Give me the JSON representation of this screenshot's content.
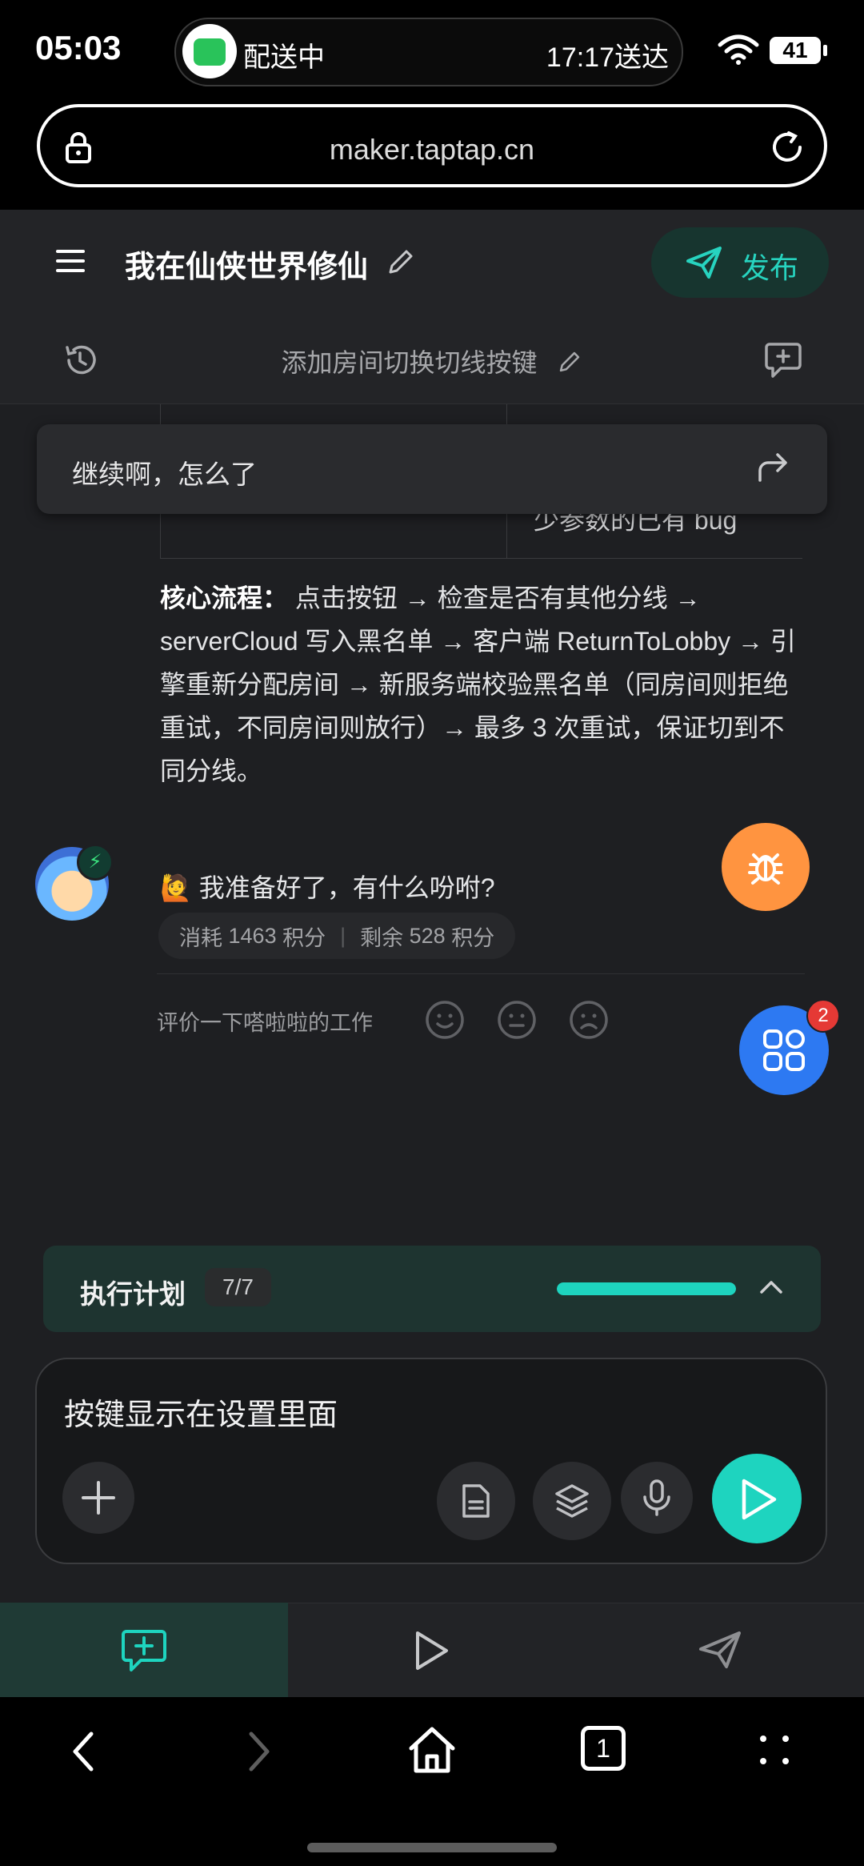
{
  "status_bar": {
    "time": "05:03",
    "live_activity_label": "配送中",
    "live_activity_eta": "17:17送达",
    "battery": "41"
  },
  "browser": {
    "url": "maker.taptap.cn"
  },
  "app": {
    "title": "我在仙侠世界修仙",
    "publish_label": "发布",
    "thread_title": "添加房间切换切线按键"
  },
  "chat": {
    "table_fragment_text": "少参数的已有 bug",
    "continue_prompt": "继续啊，怎么了",
    "core_flow_label": "核心流程：",
    "core_flow_text": "点击按钮 → 检查是否有其他分线 → serverCloud 写入黑名单 → 客户端 ReturnToLobby → 引擎重新分配房间 → 新服务端校验黑名单（同房间则拒绝重试，不同房间则放行）→ 最多 3 次重试，保证切到不同分线。",
    "ready_message": "我准备好了，有什么吩咐?",
    "ready_emoji": "🙋",
    "credits": {
      "spent_label": "消耗",
      "spent_value": "1463",
      "spent_unit": "积分",
      "separator": "|",
      "remain_label": "剩余",
      "remain_value": "528",
      "remain_unit": "积分"
    },
    "rating_prompt": "评价一下嗒啦啦的工作",
    "grid_badge_count": "2"
  },
  "plan": {
    "label": "执行计划",
    "count": "7/7",
    "progress": 1.0
  },
  "composer": {
    "value": "按键显示在设置里面"
  },
  "icons": {
    "lock": "lock-icon",
    "reload": "reload-icon",
    "menu": "menu-icon",
    "edit": "pencil-icon",
    "send": "paper-plane-icon",
    "history": "history-icon",
    "new_chat": "chat-plus-icon",
    "share": "share-arrow-icon",
    "bug": "bug-icon",
    "apps": "apps-grid-icon"
  },
  "colors": {
    "accent": "#1ed4bf",
    "bug_button": "#ff9440",
    "apps_button": "#2d79f2",
    "badge": "#e53935"
  },
  "system_nav": {
    "tab_count": "1"
  }
}
